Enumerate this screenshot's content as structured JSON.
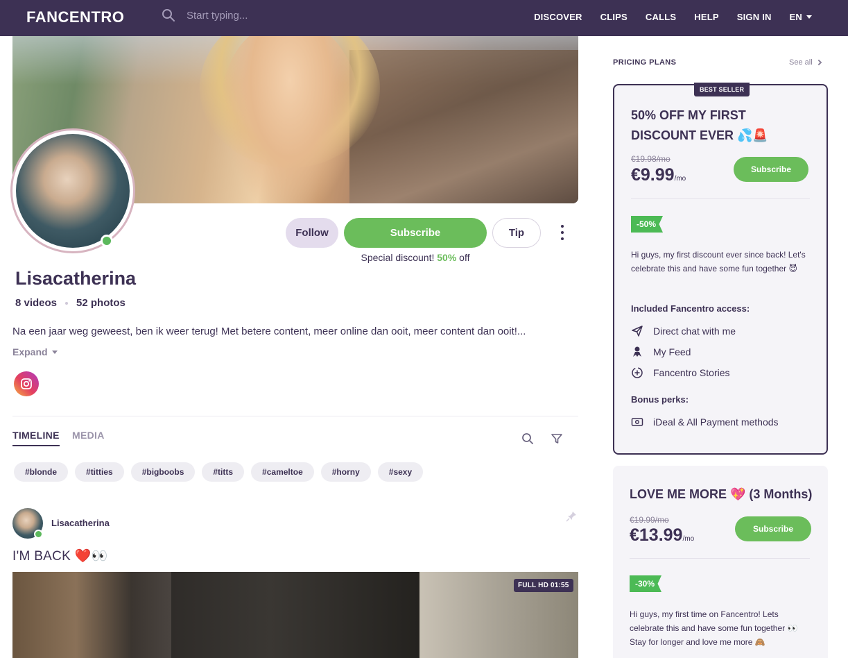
{
  "header": {
    "logo": "FANCENTRO",
    "search_placeholder": "Start typing...",
    "nav": [
      "DISCOVER",
      "CLIPS",
      "CALLS",
      "HELP",
      "SIGN IN"
    ],
    "lang": "EN"
  },
  "profile": {
    "name": "Lisacatherina",
    "videos": "8 videos",
    "photos": "52 photos",
    "bio": "Na een jaar weg geweest, ben ik weer terug! Met betere content, meer online dan ooit, meer content dan ooit!...",
    "expand": "Expand",
    "actions": {
      "follow": "Follow",
      "subscribe": "Subscribe",
      "tip": "Tip"
    },
    "discount": {
      "prefix": "Special discount!",
      "pct": "50%",
      "suffix": "off"
    }
  },
  "tabs": [
    "TIMELINE",
    "MEDIA"
  ],
  "tags": [
    "#blonde",
    "#titties",
    "#bigboobs",
    "#titts",
    "#cameltoe",
    "#horny",
    "#sexy"
  ],
  "post": {
    "author": "Lisacatherina",
    "text": "I'M BACK ❤️👀",
    "video_badge": "FULL HD 01:55"
  },
  "sidebar": {
    "heading": "PRICING PLANS",
    "see_all": "See all",
    "plans": [
      {
        "badge": "BEST SELLER",
        "title_line1": "50% OFF MY FIRST",
        "title_line2": "DISCOUNT EVER 💦🚨",
        "old_price": "€19.98/mo",
        "price": "€9.99",
        "per": "/mo",
        "subscribe": "Subscribe",
        "pct": "-50%",
        "desc": "Hi guys, my first discount ever since back! Let's celebrate this and have some fun together 😈",
        "included_title": "Included Fancentro access:",
        "included": [
          "Direct chat with me",
          "My Feed",
          "Fancentro Stories"
        ],
        "bonus_title": "Bonus perks:",
        "bonus": [
          "iDeal & All Payment methods"
        ]
      },
      {
        "title": "LOVE ME MORE 💖 (3 Months)",
        "old_price": "€19.99/mo",
        "price": "€13.99",
        "per": "/mo",
        "subscribe": "Subscribe",
        "pct": "-30%",
        "desc": "Hi guys, my first time on Fancentro! Lets celebrate this and have some fun together 👀 Stay for longer and love me more 🙈"
      }
    ]
  },
  "colors": {
    "header_bg": "#3d3154",
    "accent_green": "#6bbd5b",
    "text": "#3d3154"
  }
}
